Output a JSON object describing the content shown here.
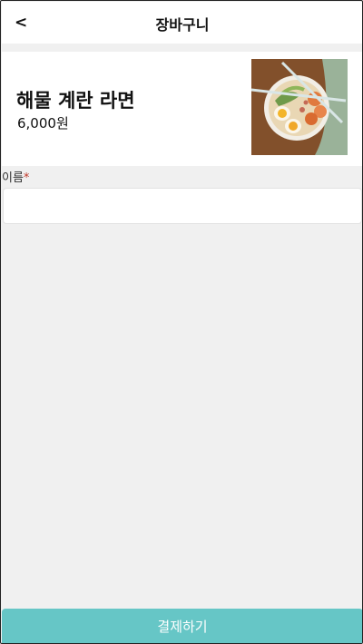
{
  "header": {
    "back_label": "<",
    "title": "장바구니"
  },
  "cart": {
    "item_name": "해물 계란 라면",
    "item_price": "6,000원",
    "image_icon": "ramen-bowl-photo"
  },
  "form": {
    "name_label": "이름",
    "required_mark": "*",
    "name_value": ""
  },
  "footer": {
    "pay_label": "결제하기"
  },
  "colors": {
    "accent": "#66c6c6",
    "required": "#c0392b",
    "background": "#f0f0f0"
  }
}
